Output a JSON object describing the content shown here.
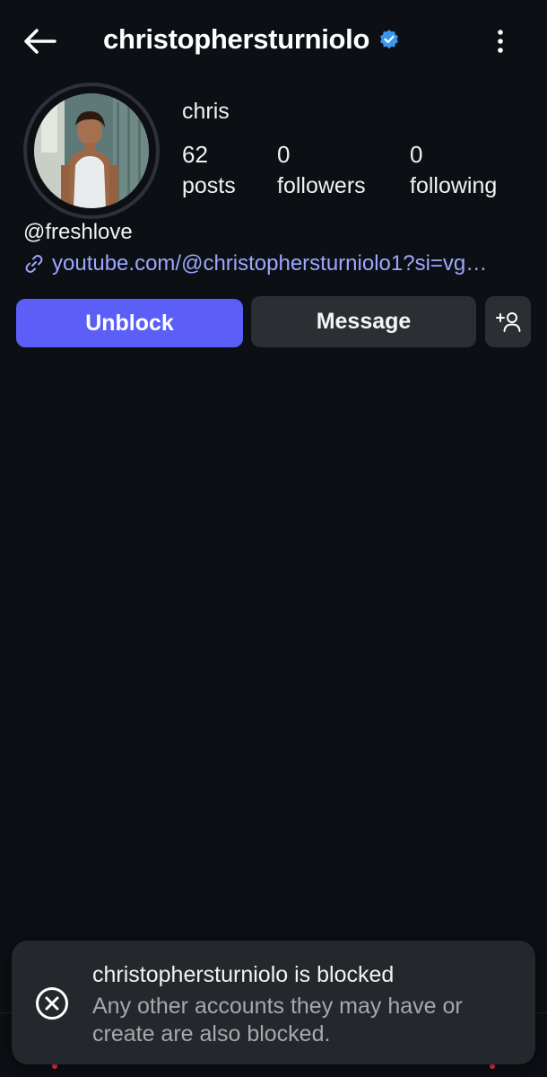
{
  "header": {
    "username": "christophersturniolo",
    "verified": true,
    "back_icon": "arrow-left-icon",
    "menu_icon": "more-vertical-icon"
  },
  "profile": {
    "name": "chris",
    "stats": [
      {
        "value": "62",
        "label": "posts"
      },
      {
        "value": "0",
        "label": "followers"
      },
      {
        "value": "0",
        "label": "following"
      }
    ],
    "handle": "@freshlove",
    "link": "youtube.com/@christophersturniolo1?si=vg…"
  },
  "actions": {
    "unblock_label": "Unblock",
    "message_label": "Message",
    "add_icon": "add-person-icon"
  },
  "bottom_nav": [
    {
      "icon": "home-icon"
    },
    {
      "icon": "search-icon"
    },
    {
      "icon": "create-icon"
    },
    {
      "icon": "reels-icon"
    },
    {
      "icon": "profile-icon"
    }
  ],
  "toast": {
    "title": "christophersturniolo is blocked",
    "body": "Any other accounts they may have or create are also blocked.",
    "icon": "close-circle-icon"
  },
  "colors": {
    "background": "#0c0f14",
    "accent": "#5b5ff8",
    "link": "#9ea7ff",
    "verified": "#3897f0",
    "notification_dot": "#ff3040"
  }
}
